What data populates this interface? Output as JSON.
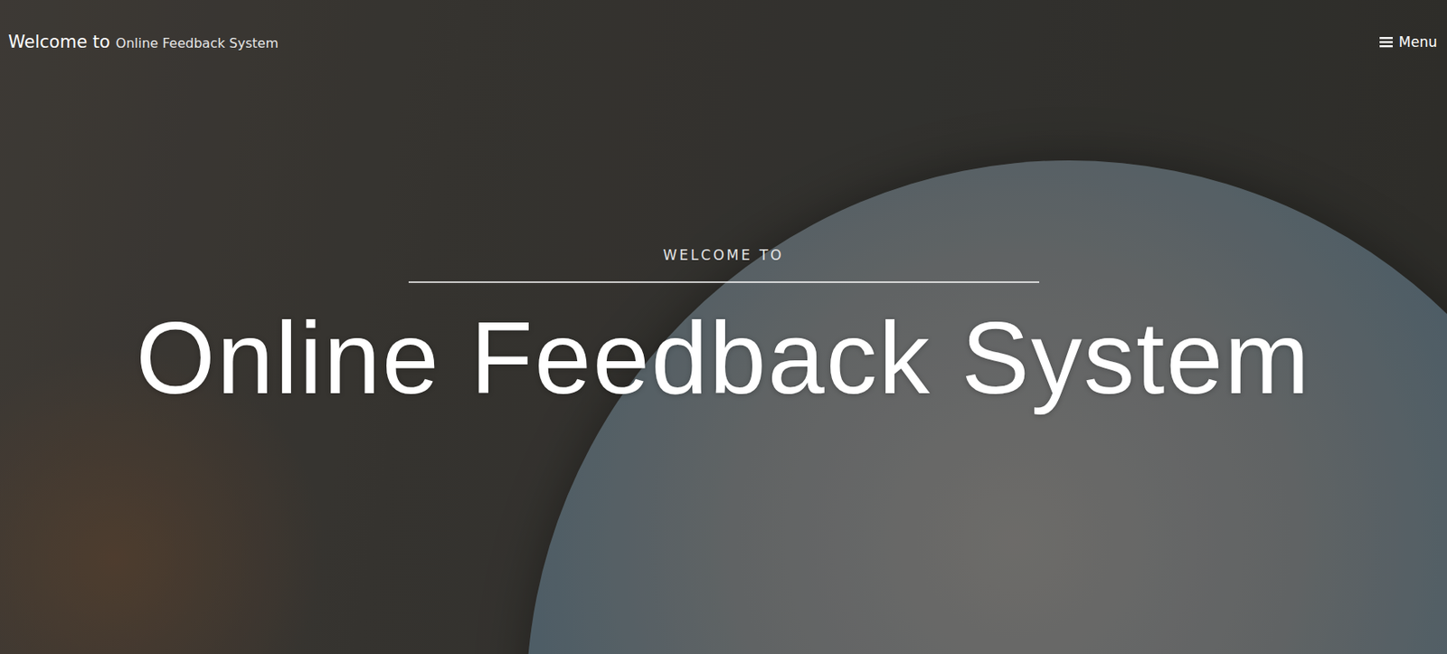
{
  "header": {
    "brand": {
      "prefix": "Welcome to",
      "name": "Online Feedback System"
    },
    "menu": {
      "label": "Menu"
    }
  },
  "hero": {
    "kicker": "WELCOME TO",
    "title": "Online Feedback System"
  }
}
